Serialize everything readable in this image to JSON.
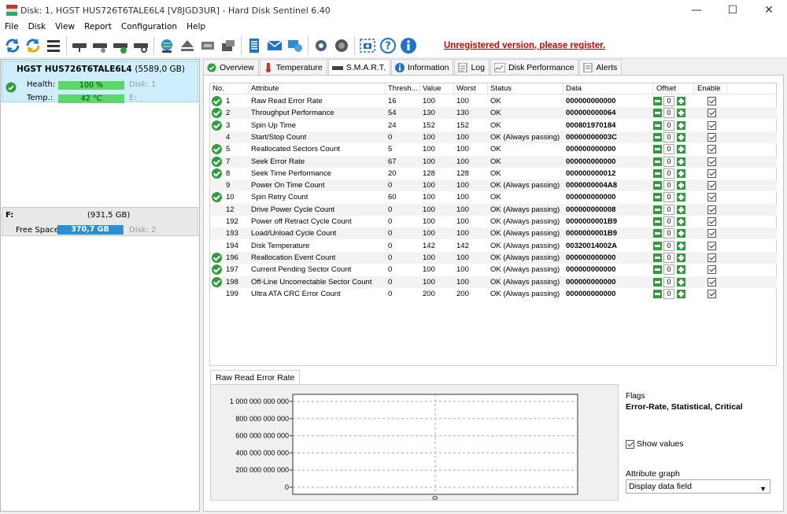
{
  "window": {
    "title": "Disk: 1, HGST HUS726T6TALE6L4 [V8JGD3UR]  -  Hard Disk Sentinel 6.40",
    "minimize": "—",
    "maximize": "☐",
    "close": "✕"
  },
  "menu": [
    "File",
    "Disk",
    "View",
    "Report",
    "Configuration",
    "Help"
  ],
  "toolbar": {
    "register_text": "Unregistered version, please register."
  },
  "disk": {
    "name": "HGST HUS726T6TALE6L4",
    "capacity": "(5589,0 GB)",
    "health_label": "Health:",
    "health_value": "100 %",
    "health_percent": 100,
    "disk_num": "Disk: 1",
    "temp_label": "Temp.:",
    "temp_value": "42 °C",
    "drive_letter": "E:"
  },
  "drive": {
    "letter": "F:",
    "size": "(931,5 GB)",
    "free_label": "Free Space",
    "free_value": "370,7 GB",
    "free_fraction": 0.398,
    "disk_num": "Disk: 2"
  },
  "tabs": [
    "Overview",
    "Temperature",
    "S.M.A.R.T.",
    "Information",
    "Log",
    "Disk Performance",
    "Alerts"
  ],
  "columns": [
    "No.",
    "Attribute",
    "Thresh...",
    "Value",
    "Worst",
    "Status",
    "Data",
    "Offset",
    "Enable"
  ],
  "rows": [
    {
      "no": "1",
      "ok": true,
      "attr": "Raw Read Error Rate",
      "thresh": "16",
      "value": "100",
      "worst": "100",
      "status": "OK",
      "data": "000000000000",
      "offset": "0"
    },
    {
      "no": "2",
      "ok": true,
      "attr": "Throughput Performance",
      "thresh": "54",
      "value": "130",
      "worst": "130",
      "status": "OK",
      "data": "000000000064",
      "offset": "0"
    },
    {
      "no": "3",
      "ok": true,
      "attr": "Spin Up Time",
      "thresh": "24",
      "value": "152",
      "worst": "152",
      "status": "OK",
      "data": "000801970184",
      "offset": "0"
    },
    {
      "no": "4",
      "ok": false,
      "attr": "Start/Stop Count",
      "thresh": "0",
      "value": "100",
      "worst": "100",
      "status": "OK (Always passing)",
      "data": "00000000003C",
      "offset": "0"
    },
    {
      "no": "5",
      "ok": true,
      "attr": "Reallocated Sectors Count",
      "thresh": "5",
      "value": "100",
      "worst": "100",
      "status": "OK",
      "data": "000000000000",
      "offset": "0"
    },
    {
      "no": "7",
      "ok": true,
      "attr": "Seek Error Rate",
      "thresh": "67",
      "value": "100",
      "worst": "100",
      "status": "OK",
      "data": "000000000000",
      "offset": "0"
    },
    {
      "no": "8",
      "ok": true,
      "attr": "Seek Time Performance",
      "thresh": "20",
      "value": "128",
      "worst": "128",
      "status": "OK",
      "data": "000000000012",
      "offset": "0"
    },
    {
      "no": "9",
      "ok": false,
      "attr": "Power On Time Count",
      "thresh": "0",
      "value": "100",
      "worst": "100",
      "status": "OK (Always passing)",
      "data": "0000000004A8",
      "offset": "0"
    },
    {
      "no": "10",
      "ok": true,
      "attr": "Spin Retry Count",
      "thresh": "60",
      "value": "100",
      "worst": "100",
      "status": "OK",
      "data": "000000000000",
      "offset": "0"
    },
    {
      "no": "12",
      "ok": false,
      "attr": "Drive Power Cycle Count",
      "thresh": "0",
      "value": "100",
      "worst": "100",
      "status": "OK (Always passing)",
      "data": "000000000008",
      "offset": "0"
    },
    {
      "no": "192",
      "ok": false,
      "attr": "Power off Retract Cycle Count",
      "thresh": "0",
      "value": "100",
      "worst": "100",
      "status": "OK (Always passing)",
      "data": "0000000001B9",
      "offset": "0"
    },
    {
      "no": "193",
      "ok": false,
      "attr": "Load/Unload Cycle Count",
      "thresh": "0",
      "value": "100",
      "worst": "100",
      "status": "OK (Always passing)",
      "data": "0000000001B9",
      "offset": "0"
    },
    {
      "no": "194",
      "ok": false,
      "attr": "Disk Temperature",
      "thresh": "0",
      "value": "142",
      "worst": "142",
      "status": "OK (Always passing)",
      "data": "00320014002A",
      "offset": "0"
    },
    {
      "no": "196",
      "ok": true,
      "attr": "Reallocation Event Count",
      "thresh": "0",
      "value": "100",
      "worst": "100",
      "status": "OK (Always passing)",
      "data": "000000000000",
      "offset": "0"
    },
    {
      "no": "197",
      "ok": true,
      "attr": "Current Pending Sector Count",
      "thresh": "0",
      "value": "100",
      "worst": "100",
      "status": "OK (Always passing)",
      "data": "000000000000",
      "offset": "0"
    },
    {
      "no": "198",
      "ok": true,
      "attr": "Off-Line Uncorrectable Sector Count",
      "thresh": "0",
      "value": "100",
      "worst": "100",
      "status": "OK (Always passing)",
      "data": "000000000000",
      "offset": "0"
    },
    {
      "no": "199",
      "ok": false,
      "attr": "Ultra ATA CRC Error Count",
      "thresh": "0",
      "value": "200",
      "worst": "200",
      "status": "OK (Always passing)",
      "data": "000000000000",
      "offset": "0"
    }
  ],
  "chart": {
    "tab_label": "Raw Read Error Rate",
    "y_ticks": [
      "1 000 000 000 000",
      "800 000 000 000",
      "600 000 000 000",
      "400 000 000 000",
      "200 000 000 000",
      "0"
    ],
    "x_marker": "0",
    "plot_bg": "#ffffff"
  },
  "chart_data": {
    "type": "line",
    "title": "Raw Read Error Rate",
    "xlabel": "",
    "ylabel": "",
    "ylim": [
      0,
      1000000000000
    ],
    "y_ticks": [
      1000000000000,
      800000000000,
      600000000000,
      400000000000,
      200000000000,
      0
    ],
    "x_ticks": [
      "0"
    ],
    "series": [],
    "grid": true
  },
  "flags": {
    "label": "Flags",
    "value": "Error-Rate, Statistical, Critical",
    "show_values": "Show values",
    "attr_graph_label": "Attribute graph",
    "attr_graph_value": "Display data field"
  }
}
